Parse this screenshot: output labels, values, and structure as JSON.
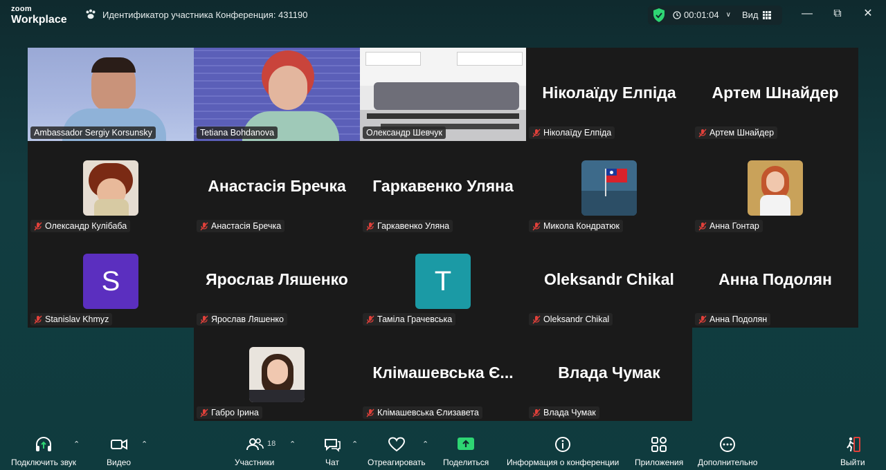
{
  "brand": {
    "line1": "zoom",
    "line2": "Workplace"
  },
  "meeting": {
    "title": "Идентификатор участника Конференция: 431190"
  },
  "timer": "00:01:04",
  "view_label": "Вид",
  "accent_colors": {
    "active_speaker": "#2ed573",
    "security_shield": "#2ed573",
    "share": "#2ed573",
    "mute": "#e0403a"
  },
  "participants": [
    {
      "name": "Ambassador Sergiy Korsunsky",
      "video": true,
      "active": true
    },
    {
      "name": "Tetiana Bohdanova",
      "video": true
    },
    {
      "name": "Олександр Шевчук",
      "video": true
    },
    {
      "name": "Ніколаїду Елпіда",
      "display": "Ніколаїду Елпіда",
      "muted": true
    },
    {
      "name": "Артем Шнайдер",
      "display": "Артем Шнайдер",
      "muted": true
    },
    {
      "name": "Олександр Кулібаба",
      "muted": true,
      "avatar": "photo"
    },
    {
      "name": "Анастасія Бречка",
      "display": "Анастасія Бречка",
      "muted": true
    },
    {
      "name": "Гаркавенко Уляна",
      "display": "Гаркавенко Уляна",
      "muted": true
    },
    {
      "name": "Микола Кондратюк",
      "muted": true,
      "avatar": "photo"
    },
    {
      "name": "Анна Гонтар",
      "muted": true,
      "avatar": "photo"
    },
    {
      "name": "Stanislav Khmyz",
      "muted": true,
      "avatar_letter": "S",
      "avatar_color": "#5b2fbf"
    },
    {
      "name": "Ярослав Ляшенко",
      "display": "Ярослав Ляшенко",
      "muted": true
    },
    {
      "name": "Таміла Грачевська",
      "muted": true,
      "avatar_letter": "T",
      "avatar_color": "#1b9aa5"
    },
    {
      "name": "Oleksandr Chikal",
      "display": "Oleksandr Chikal",
      "muted": true
    },
    {
      "name": "Анна Подолян",
      "display": "Анна Подолян",
      "muted": true
    },
    {
      "name": "Габро Ірина",
      "muted": true,
      "avatar": "photo"
    },
    {
      "name": "Клімашевська Єлизавета",
      "display": "Клімашевська Є...",
      "muted": true
    },
    {
      "name": "Влада Чумак",
      "display": "Влада Чумак",
      "muted": true
    }
  ],
  "toolbar": {
    "audio": "Подключить звук",
    "video": "Видео",
    "participants": "Участники",
    "participants_count": "18",
    "chat": "Чат",
    "react": "Отреагировать",
    "share": "Поделиться",
    "info": "Информация о конференции",
    "apps": "Приложения",
    "more": "Дополнительно",
    "leave": "Выйти"
  }
}
